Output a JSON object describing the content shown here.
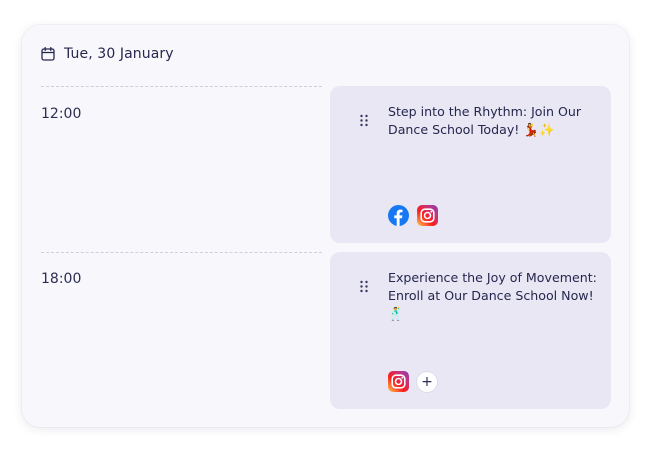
{
  "header": {
    "date": "Tue, 30 January",
    "icon": "calendar-icon"
  },
  "slots": [
    {
      "time": "12:00",
      "post": {
        "text": "Step into the Rhythm: Join Our Dance School Today! 💃✨",
        "networks": [
          "facebook-icon",
          "instagram-icon"
        ],
        "show_add": false
      }
    },
    {
      "time": "18:00",
      "post": {
        "text": "Experience the Joy of Movement: Enroll at Our Dance School Now! 🕺",
        "networks": [
          "instagram-icon"
        ],
        "show_add": true,
        "add_label": "+"
      }
    }
  ],
  "colors": {
    "card_bg": "#f8f8fc",
    "post_bg": "#e8e7f3",
    "text": "#26264f",
    "facebook": "#1877f2"
  }
}
